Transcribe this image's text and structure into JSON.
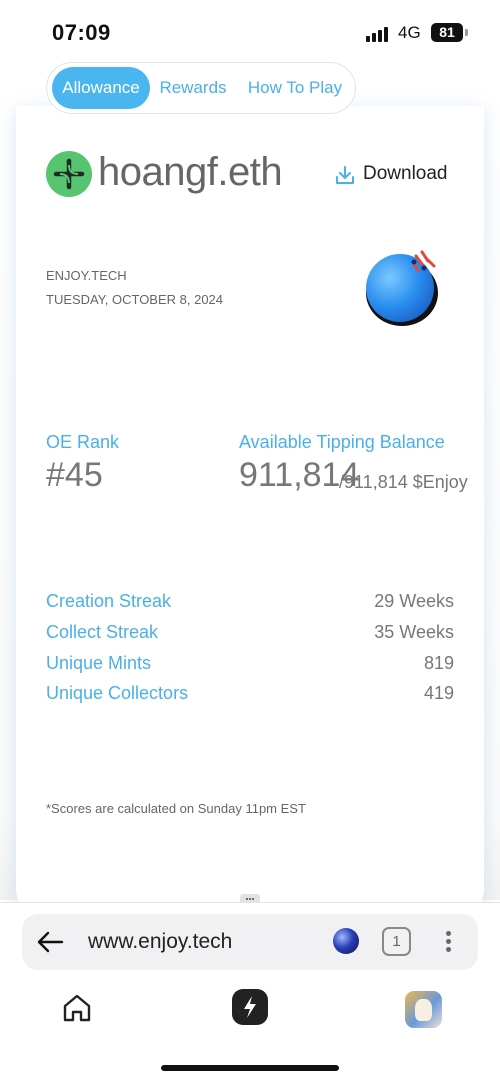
{
  "status_bar": {
    "time": "07:09",
    "network": "4G",
    "battery": "81"
  },
  "tabs": [
    {
      "label": "Allowance",
      "active": true
    },
    {
      "label": "Rewards",
      "active": false
    },
    {
      "label": "How To Play",
      "active": false
    }
  ],
  "profile": {
    "username": "hoangf.eth",
    "download_label": "Download",
    "brand": "ENJOY.TECH",
    "date": "TUESDAY, OCTOBER 8, 2024"
  },
  "rank": {
    "label": "OE Rank",
    "value": "#45"
  },
  "balance": {
    "label": "Available Tipping Balance",
    "value": "911,814",
    "total": "/911,814 $Enjoy"
  },
  "stats": [
    {
      "label": "Creation Streak",
      "value": "29 Weeks"
    },
    {
      "label": "Collect Streak",
      "value": "35 Weeks"
    },
    {
      "label": "Unique Mints",
      "value": "819"
    },
    {
      "label": "Unique Collectors",
      "value": "419"
    }
  ],
  "footnote": "*Scores are calculated on Sunday 11pm EST",
  "browser": {
    "url": "www.enjoy.tech",
    "tab_count": "1"
  },
  "colors": {
    "accent": "#4ab6f0",
    "label_blue": "#4ab0e8",
    "logo_green": "#57c46f",
    "value_gray": "#777777"
  }
}
